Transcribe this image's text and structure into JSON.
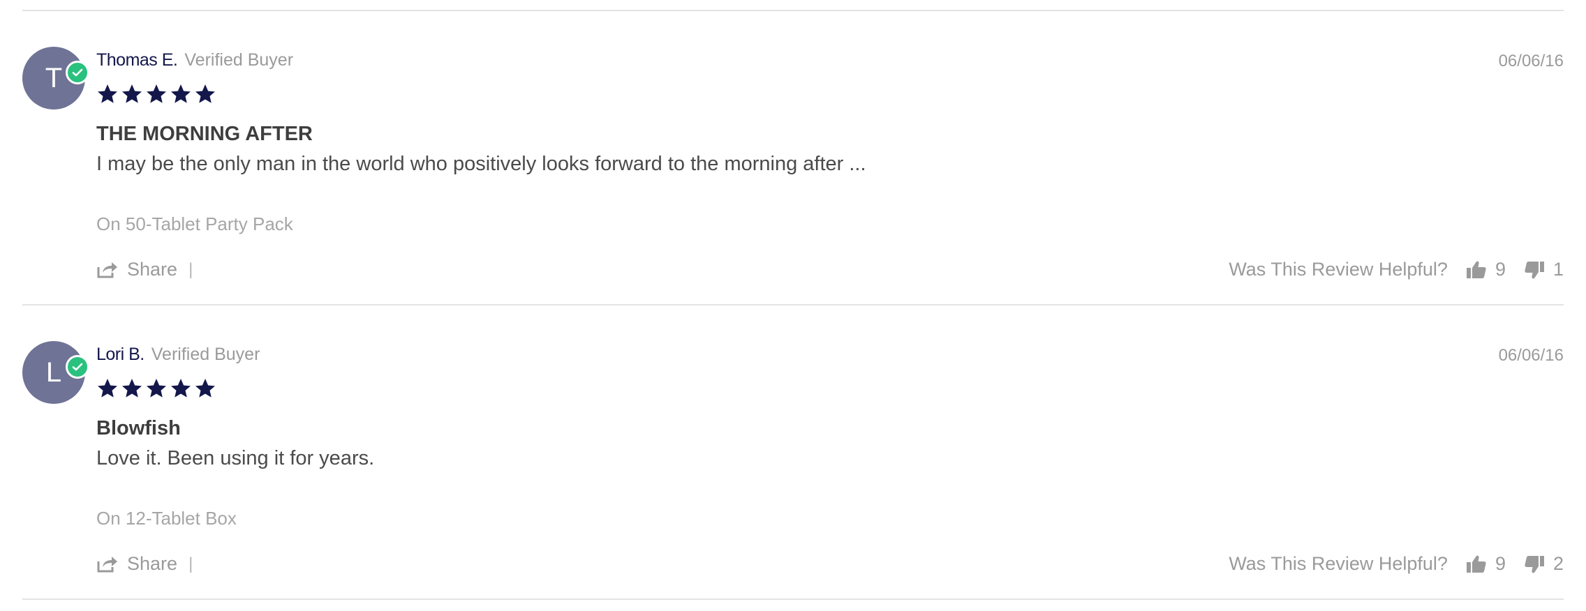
{
  "reviews": [
    {
      "avatar_initial": "T",
      "author": "Thomas E.",
      "verified_label": "Verified Buyer",
      "date": "06/06/16",
      "rating": 5,
      "title": "THE MORNING AFTER",
      "body": "I may be the only man in the world who positively looks forward to the morning after ...",
      "product": "On 50-Tablet Party Pack",
      "share_label": "Share",
      "separator": "|",
      "helpful_label": "Was This Review Helpful?",
      "upvotes": "9",
      "downvotes": "1"
    },
    {
      "avatar_initial": "L",
      "author": "Lori B.",
      "verified_label": "Verified Buyer",
      "date": "06/06/16",
      "rating": 5,
      "title": "Blowfish",
      "body": "Love it. Been using it for years.",
      "product": "On 12-Tablet Box",
      "share_label": "Share",
      "separator": "|",
      "helpful_label": "Was This Review Helpful?",
      "upvotes": "9",
      "downvotes": "2"
    }
  ],
  "colors": {
    "avatar": "#6f7396",
    "verified_badge": "#2ac17f",
    "star": "#13174a",
    "author": "#13174a",
    "muted": "#9a9a9a",
    "divider": "#e3e3e3"
  },
  "icons": {
    "star": "star-icon",
    "verified": "checkmark-icon",
    "share": "share-icon",
    "thumbs_up": "thumbs-up-icon",
    "thumbs_down": "thumbs-down-icon"
  }
}
